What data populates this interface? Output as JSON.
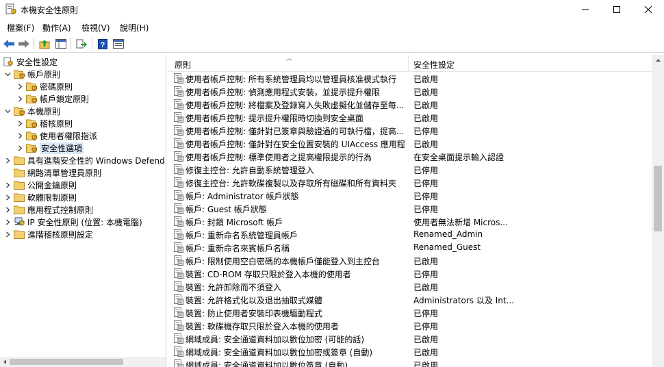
{
  "window": {
    "title": "本機安全性原則"
  },
  "menu": [
    "檔案(F)",
    "動作(A)",
    "檢視(V)",
    "說明(H)"
  ],
  "toolbar": [
    "back-icon",
    "forward-icon",
    "up-folder-icon",
    "show-tree-icon",
    "export-list-icon",
    "help-icon",
    "properties-icon"
  ],
  "tree": [
    {
      "label": "安全性設定",
      "level": 0,
      "expand": "",
      "icon": "security-settings-icon",
      "selected": false
    },
    {
      "label": "帳戶原則",
      "level": 1,
      "expand": "down",
      "icon": "folder-icon",
      "selected": false
    },
    {
      "label": "密碼原則",
      "level": 2,
      "expand": "right",
      "icon": "folder-icon",
      "selected": false
    },
    {
      "label": "帳戶鎖定原則",
      "level": 2,
      "expand": "right",
      "icon": "folder-icon",
      "selected": false
    },
    {
      "label": "本機原則",
      "level": 1,
      "expand": "down",
      "icon": "folder-icon",
      "selected": false
    },
    {
      "label": "稽核原則",
      "level": 2,
      "expand": "right",
      "icon": "folder-icon",
      "selected": false
    },
    {
      "label": "使用者權限指派",
      "level": 2,
      "expand": "right",
      "icon": "folder-icon",
      "selected": false
    },
    {
      "label": "安全性選項",
      "level": 2,
      "expand": "right",
      "icon": "folder-icon",
      "selected": true
    },
    {
      "label": "具有進階安全性的 Windows Defend",
      "level": 1,
      "expand": "right",
      "icon": "folder-icon",
      "selected": false
    },
    {
      "label": "網路清單管理員原則",
      "level": 1,
      "expand": "",
      "icon": "folder-icon",
      "selected": false
    },
    {
      "label": "公開金鑰原則",
      "level": 1,
      "expand": "right",
      "icon": "folder-icon",
      "selected": false
    },
    {
      "label": "軟體限制原則",
      "level": 1,
      "expand": "right",
      "icon": "folder-icon",
      "selected": false
    },
    {
      "label": "應用程式控制原則",
      "level": 1,
      "expand": "right",
      "icon": "folder-icon",
      "selected": false
    },
    {
      "label": "IP 安全性原則 (位置: 本機電腦)",
      "level": 1,
      "expand": "right",
      "icon": "ip-security-icon",
      "selected": false
    },
    {
      "label": "進階稽核原則設定",
      "level": 1,
      "expand": "right",
      "icon": "folder-icon",
      "selected": false
    }
  ],
  "list": {
    "headers": {
      "policy": "原則",
      "setting": "安全性設定"
    },
    "rows": [
      {
        "policy": "使用者帳戶控制: 所有系統管理員均以管理員核准模式執行",
        "setting": "已啟用"
      },
      {
        "policy": "使用者帳戶控制: 偵測應用程式安裝，並提示提升權限",
        "setting": "已啟用"
      },
      {
        "policy": "使用者帳戶控制: 將檔案及登錄寫入失敗虛擬化並儲存至每...",
        "setting": "已啟用"
      },
      {
        "policy": "使用者帳戶控制: 提示提升權限時切換到安全桌面",
        "setting": "已啟用"
      },
      {
        "policy": "使用者帳戶控制: 僅針對已簽章與驗證過的可執行檔，提高...",
        "setting": "已停用"
      },
      {
        "policy": "使用者帳戶控制: 僅針對在安全位置安裝的 UIAccess 應用程...",
        "setting": "已啟用"
      },
      {
        "policy": "使用者帳戶控制: 標準使用者之提高權限提示的行為",
        "setting": "在安全桌面提示輸入認證"
      },
      {
        "policy": "修復主控台: 允許自動系統管理登入",
        "setting": "已停用"
      },
      {
        "policy": "修復主控台: 允許軟碟複製以及存取所有磁碟和所有資料夾",
        "setting": "已停用"
      },
      {
        "policy": "帳戶: Administrator 帳戶狀態",
        "setting": "已停用"
      },
      {
        "policy": "帳戶: Guest 帳戶狀態",
        "setting": "已停用"
      },
      {
        "policy": "帳戶: 封鎖 Microsoft 帳戶",
        "setting": "使用者無法新增 Micros..."
      },
      {
        "policy": "帳戶: 重新命名系統管理員帳戶",
        "setting": "Renamed_Admin"
      },
      {
        "policy": "帳戶: 重新命名來賓帳戶名稱",
        "setting": "Renamed_Guest"
      },
      {
        "policy": "帳戶: 限制使用空白密碼的本機帳戶僅能登入到主控台",
        "setting": "已啟用"
      },
      {
        "policy": "裝置: CD-ROM 存取只限於登入本機的使用者",
        "setting": "已停用"
      },
      {
        "policy": "裝置: 允許卸除而不須登入",
        "setting": "已啟用"
      },
      {
        "policy": "裝置: 允許格式化以及退出抽取式媒體",
        "setting": "Administrators 以及 Int..."
      },
      {
        "policy": "裝置: 防止使用者安裝印表機驅動程式",
        "setting": "已停用"
      },
      {
        "policy": "裝置: 軟碟機存取只限於登入本機的使用者",
        "setting": "已停用"
      },
      {
        "policy": "網域成員: 安全通道資料加以數位加密 (可能的話)",
        "setting": "已啟用"
      },
      {
        "policy": "網域成員: 安全通道資料加以數位加密或簽章 (自動)",
        "setting": "已啟用"
      },
      {
        "policy": "網域成員: 安全通道資料加以數位簽章 (自動)",
        "setting": "已啟用"
      }
    ]
  }
}
